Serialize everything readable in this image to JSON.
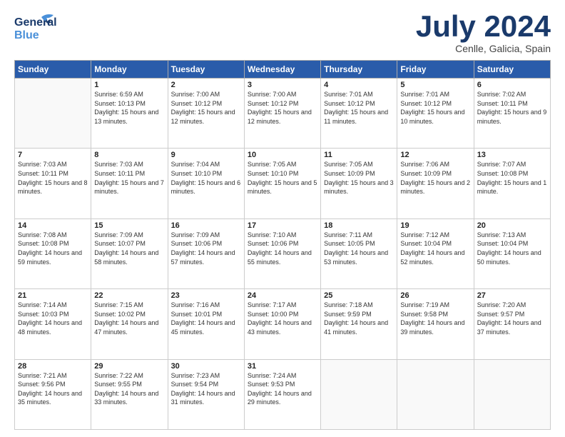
{
  "header": {
    "logo_general": "General",
    "logo_blue": "Blue",
    "month_title": "July 2024",
    "location": "Cenlle, Galicia, Spain"
  },
  "weekdays": [
    "Sunday",
    "Monday",
    "Tuesday",
    "Wednesday",
    "Thursday",
    "Friday",
    "Saturday"
  ],
  "weeks": [
    [
      {
        "day": "",
        "sunrise": "",
        "sunset": "",
        "daylight": ""
      },
      {
        "day": "1",
        "sunrise": "Sunrise: 6:59 AM",
        "sunset": "Sunset: 10:13 PM",
        "daylight": "Daylight: 15 hours and 13 minutes."
      },
      {
        "day": "2",
        "sunrise": "Sunrise: 7:00 AM",
        "sunset": "Sunset: 10:12 PM",
        "daylight": "Daylight: 15 hours and 12 minutes."
      },
      {
        "day": "3",
        "sunrise": "Sunrise: 7:00 AM",
        "sunset": "Sunset: 10:12 PM",
        "daylight": "Daylight: 15 hours and 12 minutes."
      },
      {
        "day": "4",
        "sunrise": "Sunrise: 7:01 AM",
        "sunset": "Sunset: 10:12 PM",
        "daylight": "Daylight: 15 hours and 11 minutes."
      },
      {
        "day": "5",
        "sunrise": "Sunrise: 7:01 AM",
        "sunset": "Sunset: 10:12 PM",
        "daylight": "Daylight: 15 hours and 10 minutes."
      },
      {
        "day": "6",
        "sunrise": "Sunrise: 7:02 AM",
        "sunset": "Sunset: 10:11 PM",
        "daylight": "Daylight: 15 hours and 9 minutes."
      }
    ],
    [
      {
        "day": "7",
        "sunrise": "Sunrise: 7:03 AM",
        "sunset": "Sunset: 10:11 PM",
        "daylight": "Daylight: 15 hours and 8 minutes."
      },
      {
        "day": "8",
        "sunrise": "Sunrise: 7:03 AM",
        "sunset": "Sunset: 10:11 PM",
        "daylight": "Daylight: 15 hours and 7 minutes."
      },
      {
        "day": "9",
        "sunrise": "Sunrise: 7:04 AM",
        "sunset": "Sunset: 10:10 PM",
        "daylight": "Daylight: 15 hours and 6 minutes."
      },
      {
        "day": "10",
        "sunrise": "Sunrise: 7:05 AM",
        "sunset": "Sunset: 10:10 PM",
        "daylight": "Daylight: 15 hours and 5 minutes."
      },
      {
        "day": "11",
        "sunrise": "Sunrise: 7:05 AM",
        "sunset": "Sunset: 10:09 PM",
        "daylight": "Daylight: 15 hours and 3 minutes."
      },
      {
        "day": "12",
        "sunrise": "Sunrise: 7:06 AM",
        "sunset": "Sunset: 10:09 PM",
        "daylight": "Daylight: 15 hours and 2 minutes."
      },
      {
        "day": "13",
        "sunrise": "Sunrise: 7:07 AM",
        "sunset": "Sunset: 10:08 PM",
        "daylight": "Daylight: 15 hours and 1 minute."
      }
    ],
    [
      {
        "day": "14",
        "sunrise": "Sunrise: 7:08 AM",
        "sunset": "Sunset: 10:08 PM",
        "daylight": "Daylight: 14 hours and 59 minutes."
      },
      {
        "day": "15",
        "sunrise": "Sunrise: 7:09 AM",
        "sunset": "Sunset: 10:07 PM",
        "daylight": "Daylight: 14 hours and 58 minutes."
      },
      {
        "day": "16",
        "sunrise": "Sunrise: 7:09 AM",
        "sunset": "Sunset: 10:06 PM",
        "daylight": "Daylight: 14 hours and 57 minutes."
      },
      {
        "day": "17",
        "sunrise": "Sunrise: 7:10 AM",
        "sunset": "Sunset: 10:06 PM",
        "daylight": "Daylight: 14 hours and 55 minutes."
      },
      {
        "day": "18",
        "sunrise": "Sunrise: 7:11 AM",
        "sunset": "Sunset: 10:05 PM",
        "daylight": "Daylight: 14 hours and 53 minutes."
      },
      {
        "day": "19",
        "sunrise": "Sunrise: 7:12 AM",
        "sunset": "Sunset: 10:04 PM",
        "daylight": "Daylight: 14 hours and 52 minutes."
      },
      {
        "day": "20",
        "sunrise": "Sunrise: 7:13 AM",
        "sunset": "Sunset: 10:04 PM",
        "daylight": "Daylight: 14 hours and 50 minutes."
      }
    ],
    [
      {
        "day": "21",
        "sunrise": "Sunrise: 7:14 AM",
        "sunset": "Sunset: 10:03 PM",
        "daylight": "Daylight: 14 hours and 48 minutes."
      },
      {
        "day": "22",
        "sunrise": "Sunrise: 7:15 AM",
        "sunset": "Sunset: 10:02 PM",
        "daylight": "Daylight: 14 hours and 47 minutes."
      },
      {
        "day": "23",
        "sunrise": "Sunrise: 7:16 AM",
        "sunset": "Sunset: 10:01 PM",
        "daylight": "Daylight: 14 hours and 45 minutes."
      },
      {
        "day": "24",
        "sunrise": "Sunrise: 7:17 AM",
        "sunset": "Sunset: 10:00 PM",
        "daylight": "Daylight: 14 hours and 43 minutes."
      },
      {
        "day": "25",
        "sunrise": "Sunrise: 7:18 AM",
        "sunset": "Sunset: 9:59 PM",
        "daylight": "Daylight: 14 hours and 41 minutes."
      },
      {
        "day": "26",
        "sunrise": "Sunrise: 7:19 AM",
        "sunset": "Sunset: 9:58 PM",
        "daylight": "Daylight: 14 hours and 39 minutes."
      },
      {
        "day": "27",
        "sunrise": "Sunrise: 7:20 AM",
        "sunset": "Sunset: 9:57 PM",
        "daylight": "Daylight: 14 hours and 37 minutes."
      }
    ],
    [
      {
        "day": "28",
        "sunrise": "Sunrise: 7:21 AM",
        "sunset": "Sunset: 9:56 PM",
        "daylight": "Daylight: 14 hours and 35 minutes."
      },
      {
        "day": "29",
        "sunrise": "Sunrise: 7:22 AM",
        "sunset": "Sunset: 9:55 PM",
        "daylight": "Daylight: 14 hours and 33 minutes."
      },
      {
        "day": "30",
        "sunrise": "Sunrise: 7:23 AM",
        "sunset": "Sunset: 9:54 PM",
        "daylight": "Daylight: 14 hours and 31 minutes."
      },
      {
        "day": "31",
        "sunrise": "Sunrise: 7:24 AM",
        "sunset": "Sunset: 9:53 PM",
        "daylight": "Daylight: 14 hours and 29 minutes."
      },
      {
        "day": "",
        "sunrise": "",
        "sunset": "",
        "daylight": ""
      },
      {
        "day": "",
        "sunrise": "",
        "sunset": "",
        "daylight": ""
      },
      {
        "day": "",
        "sunrise": "",
        "sunset": "",
        "daylight": ""
      }
    ]
  ]
}
